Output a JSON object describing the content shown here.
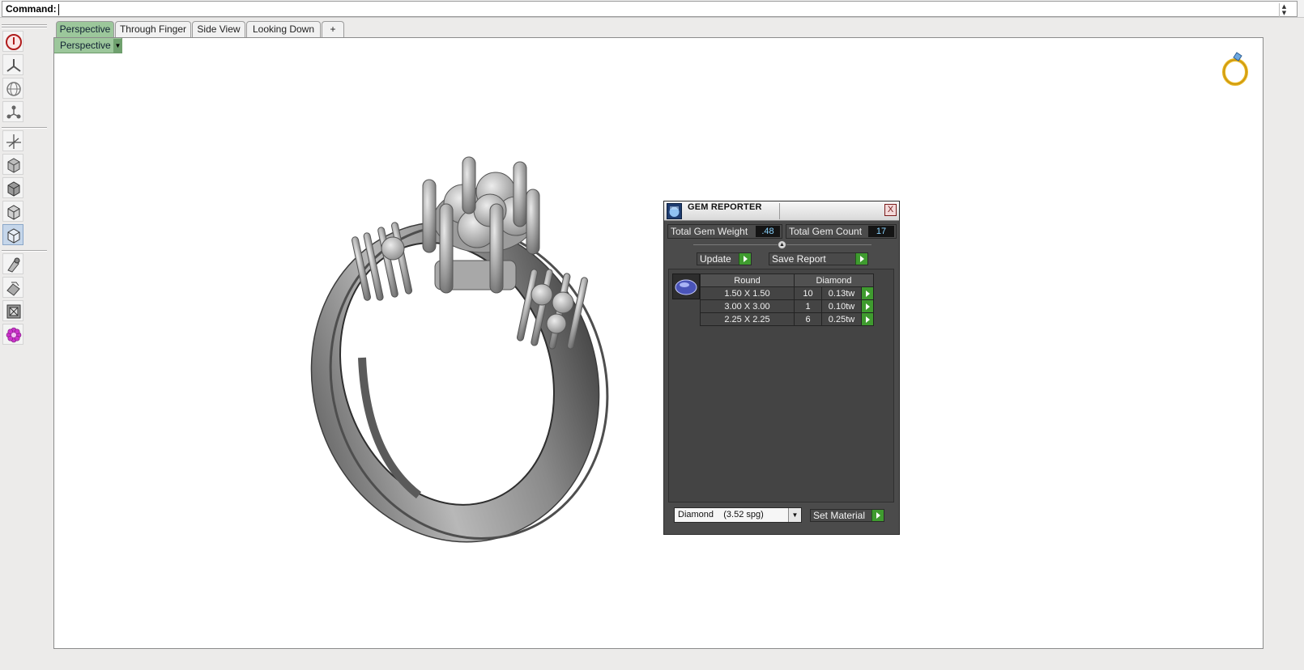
{
  "command": {
    "label": "Command:",
    "value": ""
  },
  "tabs": [
    {
      "label": "Perspective",
      "active": true
    },
    {
      "label": "Through Finger",
      "active": false
    },
    {
      "label": "Side View",
      "active": false
    },
    {
      "label": "Looking Down",
      "active": false
    }
  ],
  "tab_add_symbol": "+",
  "viewport": {
    "label": "Perspective",
    "dropdown_symbol": "▼"
  },
  "toolbar": {
    "icons": [
      "power-icon",
      "tri-axis-icon",
      "globe-icon",
      "connect-icon",
      "axes-icon",
      "cube-icon",
      "cube-shaded-icon",
      "cube-wire-icon",
      "cube-ghost-icon",
      "gem-pick-icon",
      "gem-rotate-icon",
      "frame-icon",
      "settings-flower-icon"
    ]
  },
  "gem_reporter": {
    "title": "GEM REPORTER",
    "close_symbol": "X",
    "total_weight_label": "Total Gem Weight",
    "total_weight_value": ".48",
    "total_count_label": "Total Gem Count",
    "total_count_value": "17",
    "update_label": "Update",
    "save_report_label": "Save Report",
    "table": {
      "headers": [
        "Round",
        "Diamond"
      ],
      "rows": [
        {
          "size": "1.50 X 1.50",
          "count": "10",
          "weight": "0.13tw"
        },
        {
          "size": "3.00 X 3.00",
          "count": "1",
          "weight": "0.10tw"
        },
        {
          "size": "2.25 X 2.25",
          "count": "6",
          "weight": "0.25tw"
        }
      ]
    },
    "material_value": "Diamond    (3.52 spg)",
    "set_material_label": "Set Material"
  },
  "colors": {
    "accent_green": "#3f9b2f",
    "tab_active": "#9cc79b",
    "panel_bg": "#4b4b4b",
    "value_text": "#8ad4ff"
  }
}
